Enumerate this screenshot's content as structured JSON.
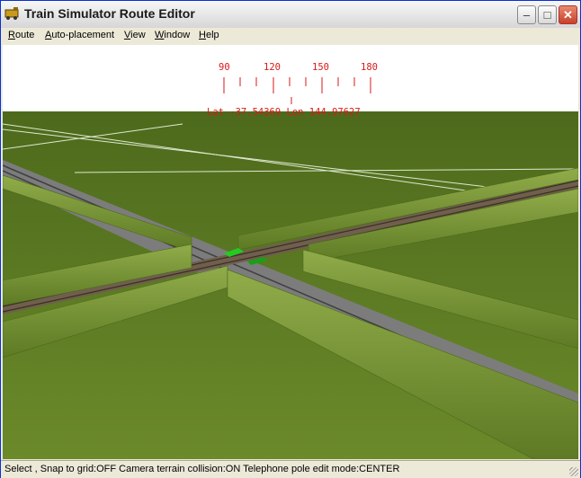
{
  "window": {
    "title": "Train Simulator Route Editor",
    "icon": "train-icon"
  },
  "titlebar_buttons": {
    "minimize": "minimize-icon",
    "maximize": "maximize-icon",
    "close": "close-icon"
  },
  "menu": [
    {
      "label": "Route",
      "u": "R",
      "rest": "oute"
    },
    {
      "label": "Auto-placement",
      "u": "A",
      "rest": "uto-placement"
    },
    {
      "label": "View",
      "u": "V",
      "rest": "iew"
    },
    {
      "label": "Window",
      "u": "W",
      "rest": "indow"
    },
    {
      "label": "Help",
      "u": "H",
      "rest": "elp"
    }
  ],
  "compass": {
    "ticks": [
      "90",
      "120",
      "150",
      "180"
    ],
    "readout": "Lat -37.54369 Lon 144.97627"
  },
  "status": {
    "text": "Select , Snap to grid:OFF Camera terrain collision:ON Telephone pole edit mode:CENTER"
  },
  "colors": {
    "grass": "#5f7a22",
    "hedge": "#7f9a3a",
    "road": "#7c7c7c",
    "hud_red": "#d81818",
    "marker_green": "#22cc22"
  }
}
